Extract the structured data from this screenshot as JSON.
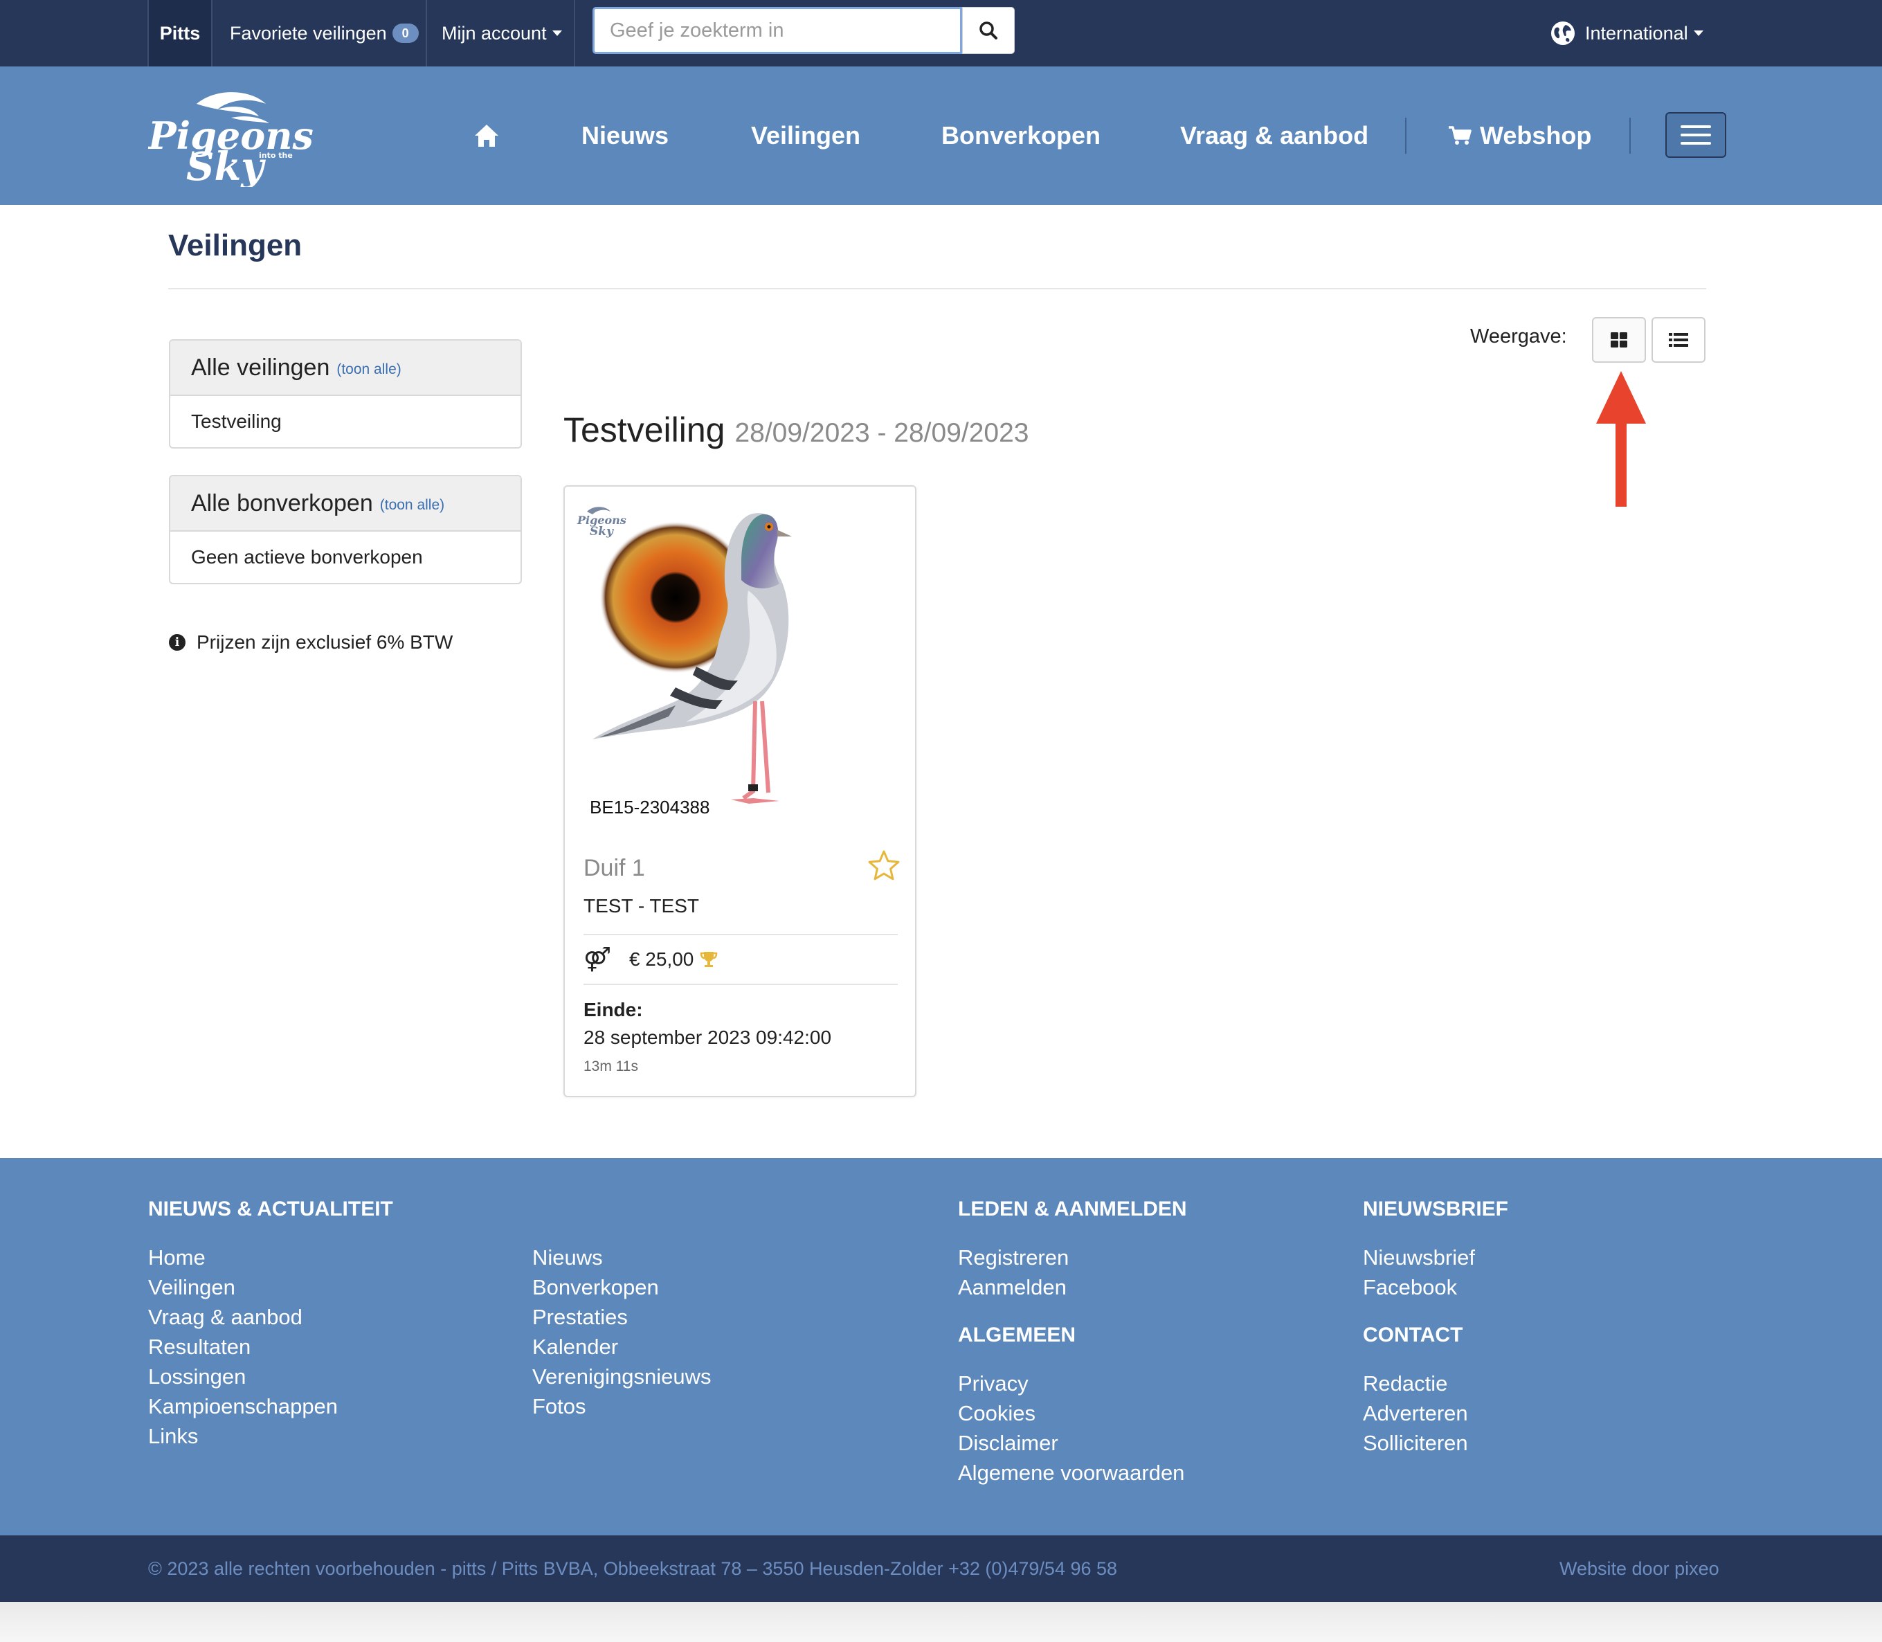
{
  "topbar": {
    "user": "Pitts",
    "favorites_label": "Favoriete veilingen",
    "favorites_count": "0",
    "account_label": "Mijn account",
    "search_placeholder": "Geef je zoekterm in",
    "language_label": "International"
  },
  "nav": {
    "items": [
      "Nieuws",
      "Veilingen",
      "Bonverkopen",
      "Vraag & aanbod"
    ],
    "webshop": "Webshop"
  },
  "page": {
    "title": "Veilingen"
  },
  "sidebar": {
    "auctions_title": "Alle veilingen",
    "auctions_show_all": "(toon alle)",
    "auctions_item": "Testveiling",
    "bonverkopen_title": "Alle bonverkopen",
    "bonverkopen_show_all": "(toon alle)",
    "bonverkopen_item": "Geen actieve bonverkopen",
    "vat_note": "Prijzen zijn exclusief 6% BTW"
  },
  "view": {
    "label": "Weergave:",
    "active": "grid"
  },
  "auction": {
    "name": "Testveiling",
    "dates": "28/09/2023 - 28/09/2023"
  },
  "card": {
    "ring_number": "BE15-2304388",
    "title": "Duif 1",
    "subtitle": "TEST - TEST",
    "gender_symbol": "⚤",
    "price": "€ 25,00",
    "end_label": "Einde:",
    "end_value": "28 september 2023 09:42:00",
    "countdown": "13m 11s"
  },
  "footer": {
    "col1_title": "NIEUWS & ACTUALITEIT",
    "col1_links": [
      "Home",
      "Veilingen",
      "Vraag & aanbod",
      "Resultaten",
      "Lossingen",
      "Kampioenschappen",
      "Links"
    ],
    "col2_links": [
      "Nieuws",
      "Bonverkopen",
      "Prestaties",
      "Kalender",
      "Verenigingsnieuws",
      "Fotos"
    ],
    "col3_title": "LEDEN & AANMELDEN",
    "col3_links": [
      "Registreren",
      "Aanmelden"
    ],
    "col3b_title": "ALGEMEEN",
    "col3b_links": [
      "Privacy",
      "Cookies",
      "Disclaimer",
      "Algemene voorwaarden"
    ],
    "col4_title": "NIEUWSBRIEF",
    "col4_links": [
      "Nieuwsbrief",
      "Facebook"
    ],
    "col4b_title": "CONTACT",
    "col4b_links": [
      "Redactie",
      "Adverteren",
      "Solliciteren"
    ],
    "copyright": "© 2023 alle rechten voorbehouden - pitts / Pitts BVBA, Obbeekstraat 78 – 3550 Heusden-Zolder +32 (0)479/54 96 58",
    "credit": "Website door pixeo"
  },
  "colors": {
    "topbar_bg": "#273759",
    "header_bg": "#5d88bb",
    "accent_arrow": "#e8432c",
    "star": "#e7b73c"
  },
  "icons": [
    "home-icon",
    "search-icon",
    "globe-icon",
    "cart-icon",
    "menu-icon",
    "grid-view-icon",
    "list-view-icon",
    "star-icon",
    "trophy-icon",
    "info-icon",
    "arrow-annotation"
  ]
}
